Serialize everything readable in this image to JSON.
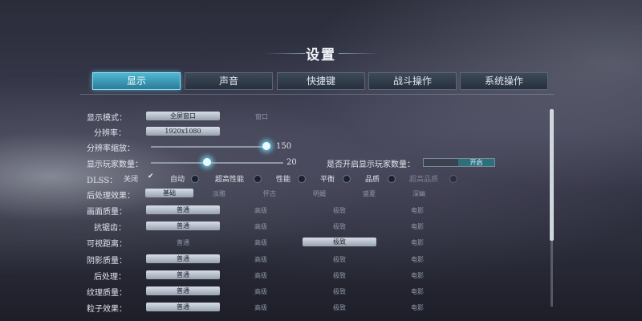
{
  "title": "设置",
  "tabs": [
    "显示",
    "声音",
    "快捷键",
    "战斗操作",
    "系统操作"
  ],
  "display_mode": {
    "label": "显示模式：",
    "options": [
      "全屏窗口",
      "窗口"
    ]
  },
  "resolution": {
    "label": "分辨率：",
    "value": "1920x1080"
  },
  "resolution_scale": {
    "label": "分辨率缩放：",
    "value": "150",
    "fill_fraction": 1.0
  },
  "player_count": {
    "label": "显示玩家数量：",
    "value": "20",
    "fill_fraction": 0.4
  },
  "player_count_toggle": {
    "label": "是否开启显示玩家数量：",
    "on_label": "开启"
  },
  "dlss": {
    "label": "DLSS：",
    "options": [
      "关闭",
      "自动",
      "超高性能",
      "性能",
      "平衡",
      "品质",
      "超高品质"
    ]
  },
  "post_effect": {
    "label": "后处理效果：",
    "options": [
      "基础",
      "淡雅",
      "怀古",
      "明媚",
      "盛夏",
      "深幽"
    ]
  },
  "quality_rows": [
    {
      "label": "画面质量：",
      "options": [
        "普通",
        "高级",
        "极致",
        "电影"
      ],
      "selected": 0
    },
    {
      "label": "抗锯齿：",
      "options": [
        "普通",
        "高级",
        "极致",
        "电影"
      ],
      "selected": 0
    },
    {
      "label": "可视距离：",
      "options": [
        "普通",
        "高级",
        "极致",
        "电影"
      ],
      "selected": 2
    },
    {
      "label": "阴影质量：",
      "options": [
        "普通",
        "高级",
        "极致",
        "电影"
      ],
      "selected": 0
    },
    {
      "label": "后处理：",
      "options": [
        "普通",
        "高级",
        "极致",
        "电影"
      ],
      "selected": 0
    },
    {
      "label": "纹理质量：",
      "options": [
        "普通",
        "高级",
        "极致",
        "电影"
      ],
      "selected": 0
    },
    {
      "label": "粒子效果：",
      "options": [
        "普通",
        "高级",
        "极致",
        "电影"
      ],
      "selected": 0
    }
  ]
}
